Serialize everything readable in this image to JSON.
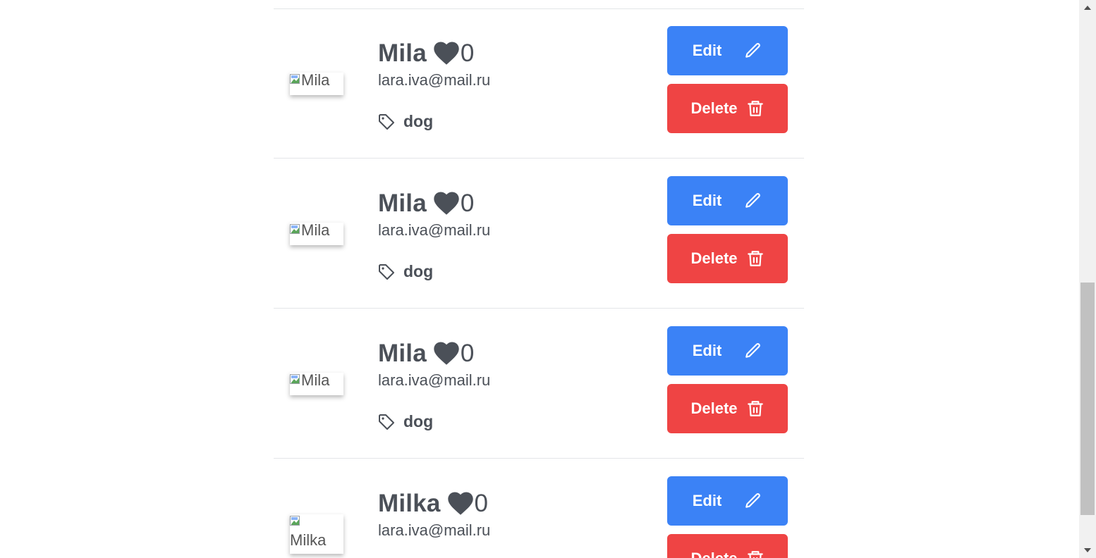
{
  "pets": [
    {
      "name": "Mila",
      "likes": "0",
      "email": "lara.iva@mail.ru",
      "tag": "dog",
      "image_alt": "Mila",
      "edit_label": "Edit",
      "delete_label": "Delete"
    },
    {
      "name": "Mila",
      "likes": "0",
      "email": "lara.iva@mail.ru",
      "tag": "dog",
      "image_alt": "Mila",
      "edit_label": "Edit",
      "delete_label": "Delete"
    },
    {
      "name": "Mila",
      "likes": "0",
      "email": "lara.iva@mail.ru",
      "tag": "dog",
      "image_alt": "Mila",
      "edit_label": "Edit",
      "delete_label": "Delete"
    },
    {
      "name": "Milka",
      "likes": "0",
      "email": "lara.iva@mail.ru",
      "tag": "dog",
      "image_alt": "Milka",
      "edit_label": "Edit",
      "delete_label": "Delete"
    }
  ],
  "icons": {
    "like": "heart-icon",
    "tag": "tag-icon",
    "edit": "pencil-icon",
    "delete": "trash-icon",
    "image": "broken-image-icon"
  },
  "colors": {
    "edit_button": "#3b82f6",
    "delete_button": "#ef4444",
    "text": "#4b5058",
    "divider": "#e3e5e8"
  }
}
